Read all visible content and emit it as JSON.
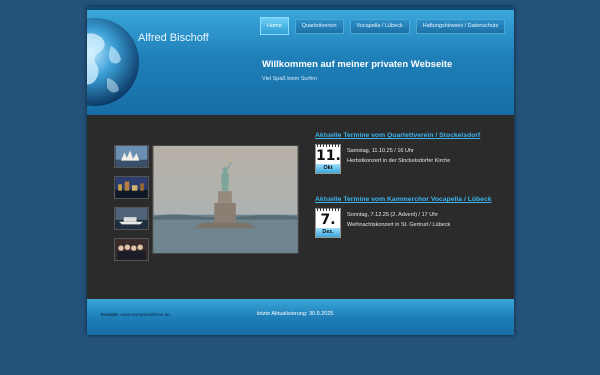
{
  "site": {
    "title": "Alfred Bischoff"
  },
  "nav": {
    "items": [
      {
        "label": "Home"
      },
      {
        "label": "Quartettverein"
      },
      {
        "label": "Vocapella / Lübeck"
      },
      {
        "label": "Haftungshinweis / Datenschutz"
      }
    ]
  },
  "welcome": {
    "title": "Willkommen auf meiner privaten Webseite",
    "subtitle": "Viel Spaß beim Surfen"
  },
  "events": [
    {
      "heading": "Aktuelle Termine vom Quartettverein / Stockelsdorf",
      "day": "11.",
      "month": "Okt",
      "line1": "Samstag, 11.10.25 / 16 Uhr",
      "line2": "Herbstkonzert in der Stockelsdorfer Kirche"
    },
    {
      "heading": "Aktuelle Termine vom Kammerchor Vocapella / Lübeck",
      "day": "7.",
      "month": "Dez.",
      "line1": "Sonntag, 7.12.25 (2. Advent) / 17 Uhr",
      "line2": "Weihnachtskonzert in St. Gertrud / Lübeck"
    }
  ],
  "footer": {
    "contact_label": "Kontakt:",
    "contact_value": "www.stompsedeferne.de",
    "update": "letzte Aktualisierung: 30.9.2025"
  },
  "colors": {
    "background": "#24527a",
    "header": "#1f7fb8",
    "content": "#2b2b2b",
    "link": "#3cb4ee"
  }
}
